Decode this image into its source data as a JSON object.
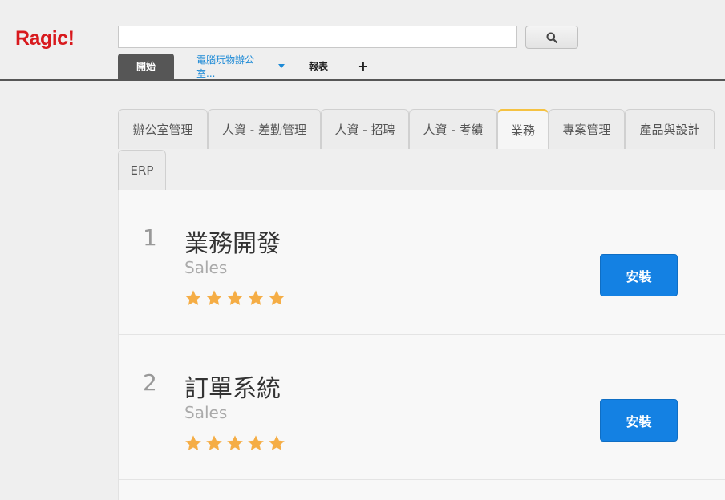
{
  "brand": {
    "name": "Ragic!"
  },
  "search": {
    "value": "",
    "placeholder": ""
  },
  "topnav": {
    "start": "開始",
    "app": "電腦玩物辦公室...",
    "reports": "報表",
    "add": "+"
  },
  "tabs": [
    {
      "label": "辦公室管理",
      "active": false
    },
    {
      "label": "人資 - 差勤管理",
      "active": false
    },
    {
      "label": "人資 - 招聘",
      "active": false
    },
    {
      "label": "人資 - 考績",
      "active": false
    },
    {
      "label": "業務",
      "active": true
    },
    {
      "label": "專案管理",
      "active": false
    },
    {
      "label": "產品與設計",
      "active": false
    },
    {
      "label": "ERP",
      "active": false
    }
  ],
  "apps": [
    {
      "rank": "1",
      "title": "業務開發",
      "subtitle": "Sales",
      "rating": 5,
      "button": "安裝"
    },
    {
      "rank": "2",
      "title": "訂單系統",
      "subtitle": "Sales",
      "rating": 5,
      "button": "安裝"
    }
  ],
  "colors": {
    "logo": "#d8191d",
    "accent": "#1481e3",
    "star": "#f5ad45",
    "active_tab_marker": "#f5c242",
    "nav_bar": "#565656"
  }
}
